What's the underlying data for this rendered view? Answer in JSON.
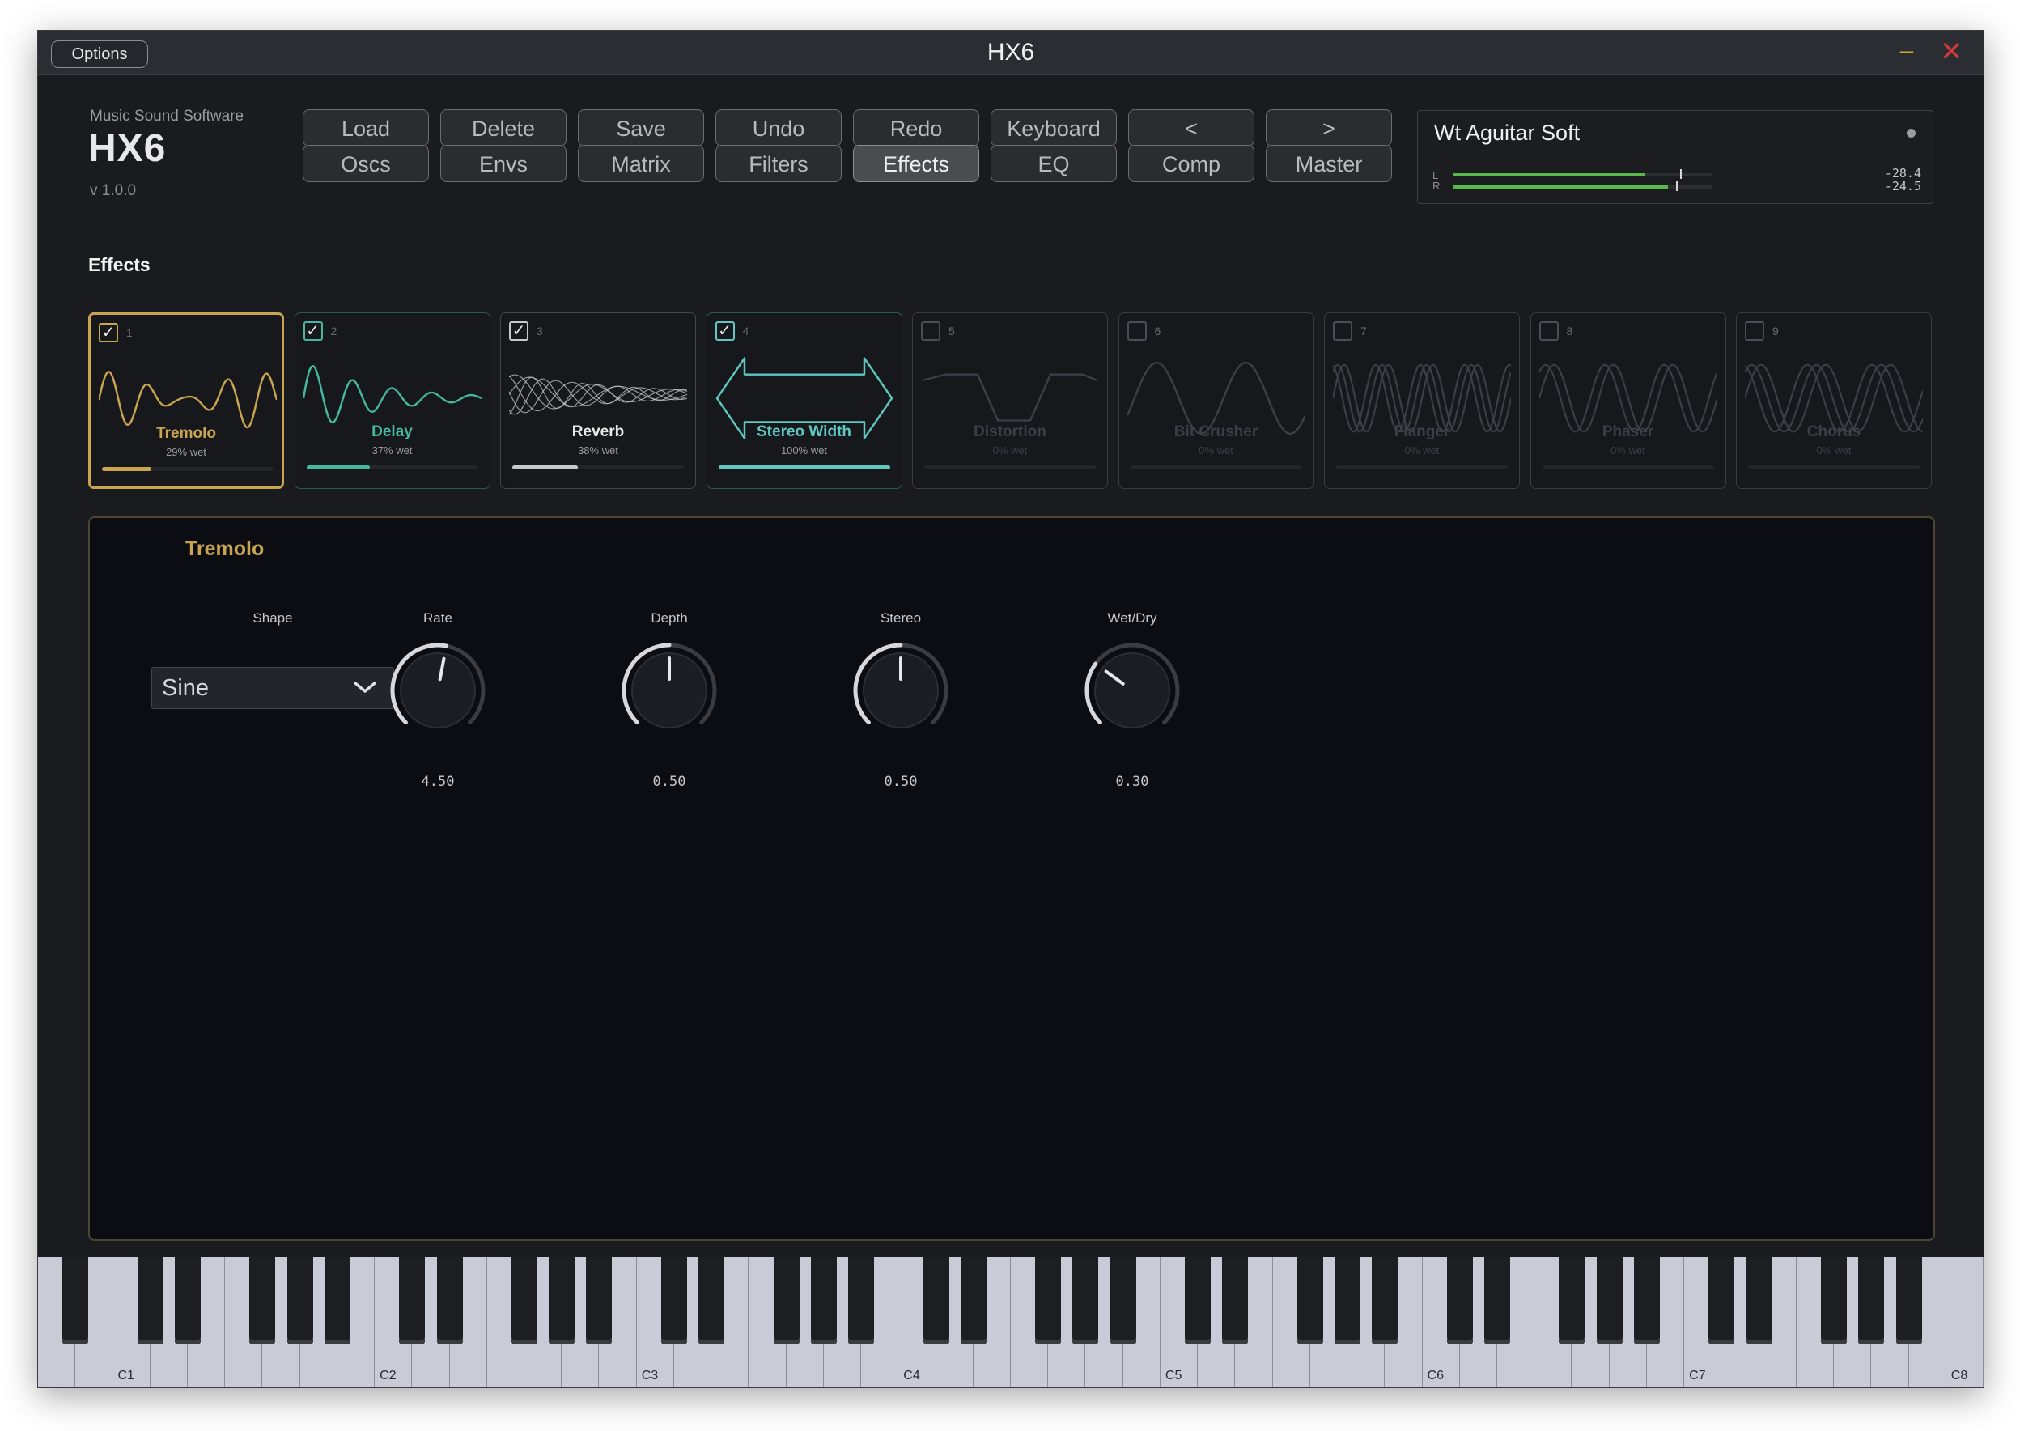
{
  "window": {
    "title": "HX6",
    "options_label": "Options"
  },
  "brand": {
    "vendor": "Music Sound Software",
    "name": "HX6",
    "version": "v 1.0.0"
  },
  "toolbar": {
    "row1": [
      "Load",
      "Delete",
      "Save",
      "Undo",
      "Redo",
      "Keyboard",
      "<",
      ">"
    ],
    "row2": [
      "Oscs",
      "Envs",
      "Matrix",
      "Filters",
      "Effects",
      "EQ",
      "Comp",
      "Master"
    ],
    "active": "Effects"
  },
  "preset": {
    "name": "Wt Aguitar Soft",
    "meter": {
      "left_label": "L",
      "right_label": "R",
      "left_value": "-28.4",
      "right_value": "-24.5",
      "left_level": 0.84,
      "right_level": 0.94,
      "left_peak": 0.95,
      "right_peak": 0.93
    }
  },
  "effects_section": {
    "title": "Effects"
  },
  "slots": [
    {
      "num": "1",
      "name": "Tremolo",
      "wet": "29% wet",
      "enabled": true,
      "level": 0.29,
      "color": "#c9a551",
      "icon": "tremolo-wave-icon"
    },
    {
      "num": "2",
      "name": "Delay",
      "wet": "37% wet",
      "enabled": true,
      "level": 0.37,
      "color": "#46b8a0",
      "icon": "delay-wave-icon"
    },
    {
      "num": "3",
      "name": "Reverb",
      "wet": "38% wet",
      "enabled": true,
      "level": 0.38,
      "color": "#c8c8cc",
      "icon": "reverb-wave-icon"
    },
    {
      "num": "4",
      "name": "Stereo Width",
      "wet": "100% wet",
      "enabled": true,
      "level": 1.0,
      "color": "#5fc8c0",
      "icon": "stereo-width-arrow-icon"
    },
    {
      "num": "5",
      "name": "Distortion",
      "wet": "0% wet",
      "enabled": false,
      "level": 0,
      "color": "#3c3e48",
      "icon": "distortion-wave-icon"
    },
    {
      "num": "6",
      "name": "Bit Crusher",
      "wet": "0% wet",
      "enabled": false,
      "level": 0,
      "color": "#3c3e48",
      "icon": "bitcrusher-wave-icon"
    },
    {
      "num": "7",
      "name": "Flanger",
      "wet": "0% wet",
      "enabled": false,
      "level": 0,
      "color": "#3c3e48",
      "icon": "flanger-wave-icon"
    },
    {
      "num": "8",
      "name": "Phaser",
      "wet": "0% wet",
      "enabled": false,
      "level": 0,
      "color": "#3c3e48",
      "icon": "phaser-wave-icon"
    },
    {
      "num": "9",
      "name": "Chorus",
      "wet": "0% wet",
      "enabled": false,
      "level": 0,
      "color": "#3c3e48",
      "icon": "chorus-wave-icon"
    }
  ],
  "panel": {
    "title": "Tremolo",
    "shape": {
      "label": "Shape",
      "value": "Sine"
    },
    "knobs": [
      {
        "label": "Rate",
        "value": "4.50",
        "position": 0.54
      },
      {
        "label": "Depth",
        "value": "0.50",
        "position": 0.5
      },
      {
        "label": "Stereo",
        "value": "0.50",
        "position": 0.5
      },
      {
        "label": "Wet/Dry",
        "value": "0.30",
        "position": 0.3
      }
    ]
  },
  "keyboard": {
    "octave_labels": [
      "C1",
      "C2",
      "C3",
      "C4",
      "C5",
      "C6",
      "C7",
      "C8"
    ]
  },
  "colors": {
    "accent": "#c9a551",
    "background": "#1a1b1e",
    "panel": "#0c0d12"
  }
}
